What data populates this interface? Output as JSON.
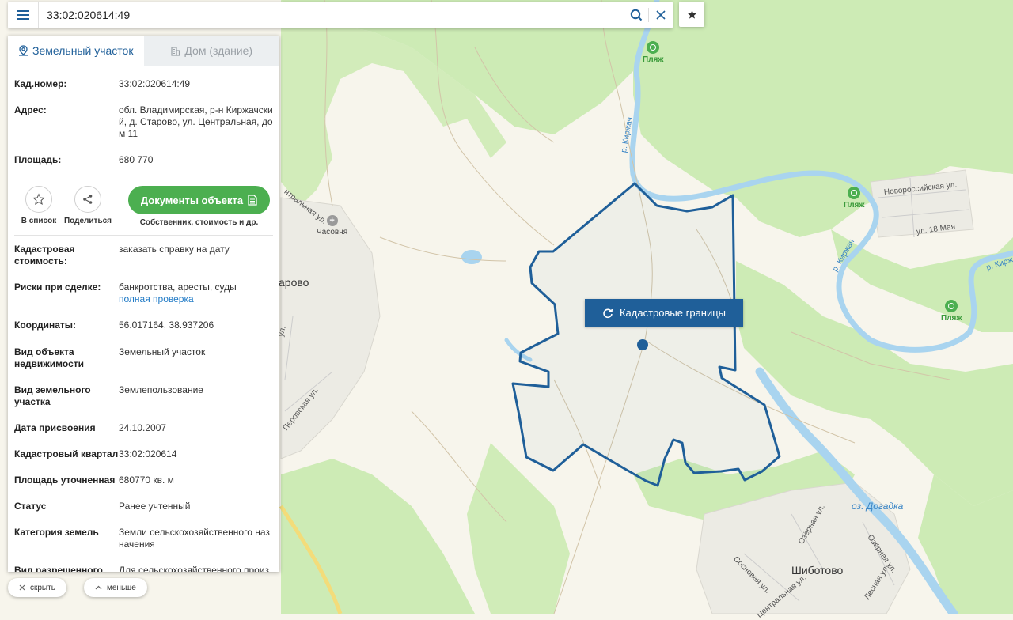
{
  "search": {
    "value": "33:02:020614:49",
    "placeholder": ""
  },
  "tabs": {
    "land": "Земельный участок",
    "house": "Дом (здание)"
  },
  "basic": [
    {
      "label": "Кад.номер:",
      "value": "33:02:020614:49",
      "is_link": true
    },
    {
      "label": "Адрес:",
      "value": "обл. Владимирская, р-н Киржачский, д. Старово, ул. Центральная, дом 11"
    },
    {
      "label": "Площадь:",
      "value": "680 770"
    }
  ],
  "actions": {
    "add_list": "В список",
    "share": "Поделиться",
    "docs_button": "Документы объекта",
    "docs_sub": "Собственник, стоимость и др."
  },
  "cadastral_value": {
    "label": "Кадастровая стоимость:",
    "link": "заказать справку на дату"
  },
  "risks": {
    "label": "Риски при сделке:",
    "value": "банкротства, аресты, суды",
    "link": "полная проверка"
  },
  "coords": {
    "label": "Координаты:",
    "value": "56.017164, 38.937206"
  },
  "details": [
    {
      "label": "Вид объекта недвижимости",
      "value": "Земельный участок"
    },
    {
      "label": "Вид земельного участка",
      "value": "Землепользование"
    },
    {
      "label": "Дата присвоения",
      "value": "24.10.2007"
    },
    {
      "label": "Кадастровый квартал",
      "value": "33:02:020614"
    },
    {
      "label": "Площадь уточненная",
      "value": "680770 кв. м"
    },
    {
      "label": "Статус",
      "value": "Ранее учтенный"
    },
    {
      "label": "Категория земель",
      "value": "Земли сельскохозяйственного назначения"
    },
    {
      "label": "Вид разрешенного использования",
      "value": "Для сельскохозяйственного производства"
    }
  ],
  "bottom": {
    "hide": "скрыть",
    "less": "меньше"
  },
  "map": {
    "cadastral_button": "Кадастровые границы",
    "labels": {
      "village_starovo": "арово",
      "village_shibotovo": "Шиботово",
      "chapel": "Часовня",
      "beach": "Пляж",
      "lake": "оз. Догадка",
      "river": "р. Киржач",
      "river_short": "р. Кирж",
      "river_2": "р. Киржач",
      "st_tsentralnaya": "нтральная ул.",
      "st_tsentralnaya_2": "Центральная ул.",
      "st_novorossiyskaya": "Новороссийская ул.",
      "st_18maya": "ул. 18 Мая",
      "st_perovskaya": "Перовская ул.",
      "st_sosnovaya": "Сосновая ул.",
      "st_ozernaya": "Озёрная ул.",
      "st_ozernaya_2": "Озёрная ул.",
      "st_lesnaya": "Лесная ул.",
      "st_unnamed": "ул."
    },
    "colors": {
      "forest": "#cdebb5",
      "field": "#f7f5ec",
      "water": "#a9d4ef",
      "boundary": "#1f5f99",
      "accent": "#4caf50"
    }
  }
}
